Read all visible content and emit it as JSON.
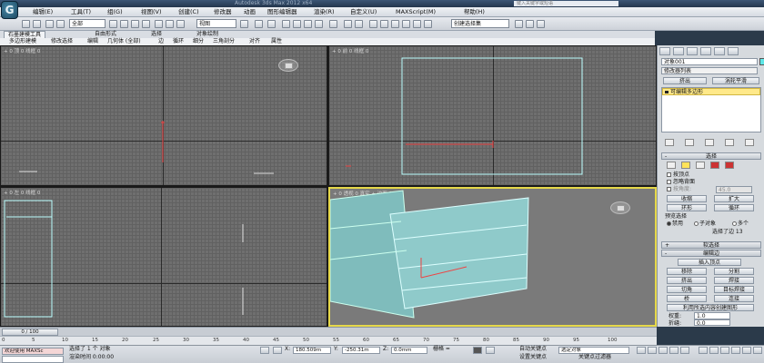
{
  "titlebar": {
    "title": "Autodesk 3ds Max 2012 x64",
    "search_placeholder": "键入关键字或短语"
  },
  "app_button": {
    "glyph": "G"
  },
  "menubar": {
    "items": [
      "编辑(E)",
      "工具(T)",
      "组(G)",
      "视图(V)",
      "创建(C)",
      "修改器",
      "动画",
      "图形编辑器",
      "渲染(R)",
      "自定义(U)",
      "MAXScript(M)",
      "帮助(H)"
    ]
  },
  "toolbar": {
    "filter_select": "全部",
    "view_select": "视图",
    "selection_set": "创建选择集"
  },
  "ribbon": {
    "tabs": [
      "石墨建模工具",
      "自由形式",
      "选择",
      "对象绘制"
    ],
    "subtabs": [
      "多边形建模",
      "修改选择",
      "编辑",
      "几何体 (全部)",
      "边",
      "循环",
      "细分",
      "三角剖分",
      "对齐",
      "属性"
    ]
  },
  "viewports": {
    "top": {
      "label": "+ 0 顶 0 线框 0"
    },
    "front": {
      "label": "+ 0 前 0 线框 0"
    },
    "left": {
      "label": "+ 0 左 0 线框 0"
    },
    "persp": {
      "label": "+ 0 透视 0 真实 + 边面 0"
    }
  },
  "command_panel": {
    "object_name": "对象001",
    "modifier_list": "修改器列表",
    "btn_select": "挤出",
    "btn_turbosmooth": "涡轮平滑",
    "stack_item": "可编辑多边形",
    "rollout_select": "选择",
    "by_vertex": "按顶点",
    "ignore_backface": "忽略背面",
    "by_angle": "按角度:",
    "angle_value": "45.0",
    "shrink": "收缩",
    "grow": "扩大",
    "ring": "环形",
    "loop": "循环",
    "preview_select": "预览选择",
    "disabled": "禁用",
    "subobject": "子对象",
    "multi": "多个",
    "selected_count": "选择了边 13",
    "soft_selection": "软选择",
    "edit_edges": "编辑边",
    "insert_vertex": "插入顶点",
    "remove": "移除",
    "split": "分割",
    "extrude": "挤出",
    "weld": "焊接",
    "chamfer": "切角",
    "target_weld": "目标焊接",
    "bridge": "桥",
    "connect": "连接",
    "create_shape": "利用所选内容创建图形",
    "weight_label": "权重:",
    "weight_value": "1.0",
    "crease_label": "折缝:",
    "crease_value": "0.0",
    "edit_tri": "编辑三角形",
    "turn": "旋转"
  },
  "timeline": {
    "slider_label": "0 / 100"
  },
  "ruler": {
    "ticks": [
      "0",
      "5",
      "10",
      "15",
      "20",
      "25",
      "30",
      "35",
      "40",
      "45",
      "50",
      "55",
      "60",
      "65",
      "70",
      "75",
      "80",
      "85",
      "90",
      "95",
      "100"
    ]
  },
  "statusbar": {
    "welcome": "欢迎使用 MAXSc",
    "selected": "选择了 1 个 对象",
    "render_time": "渲染时间 0:00:00",
    "x_label": "X:",
    "x_value": "180.509m",
    "y_label": "Y:",
    "y_value": "-250.31m",
    "z_label": "Z:",
    "z_value": "0.0mm",
    "grid": "栅格 =",
    "auto_key": "自动关键点",
    "set_key": "设置关键点",
    "key_filter": "关键点过滤器",
    "selected_obj": "选定对象",
    "add_time_tag": "添加时间标记"
  }
}
